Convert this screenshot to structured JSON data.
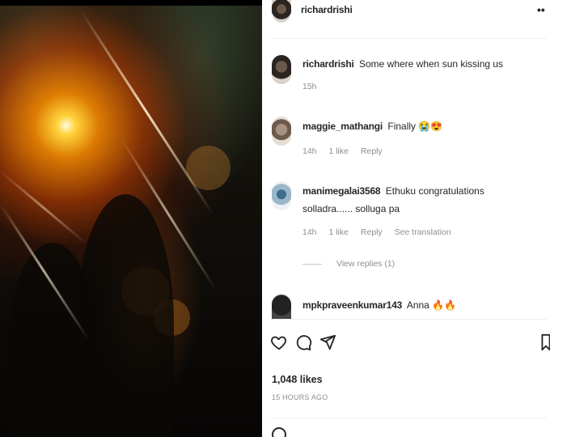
{
  "post": {
    "author": "richardrishi",
    "more_label": "••"
  },
  "comments": [
    {
      "username": "richardrishi",
      "text": "Some where when sun kissing us",
      "time": "15h",
      "likes": "",
      "reply": "",
      "translate": ""
    },
    {
      "username": "maggie_mathangi",
      "text": "Finally 😭😍",
      "time": "14h",
      "likes": "1 like",
      "reply": "Reply",
      "translate": ""
    },
    {
      "username": "manimegalai3568",
      "text": "Ethuku congratulations solladra...... solluga pa",
      "time": "14h",
      "likes": "1 like",
      "reply": "Reply",
      "translate": "See translation"
    },
    {
      "username": "mpkpraveenkumar143",
      "text": "Anna 🔥🔥",
      "time": "",
      "likes": "",
      "reply": "",
      "translate": ""
    }
  ],
  "view_replies": "View replies (1)",
  "likes_count": "1,048 likes",
  "posted_ago": "15 HOURS AGO",
  "icons": {
    "like": "heart-icon",
    "comment": "comment-icon",
    "share": "paper-plane-icon",
    "save": "bookmark-icon"
  },
  "colors": {
    "text": "#262626",
    "secondary": "#8e8e8e",
    "divider": "#efefef"
  }
}
